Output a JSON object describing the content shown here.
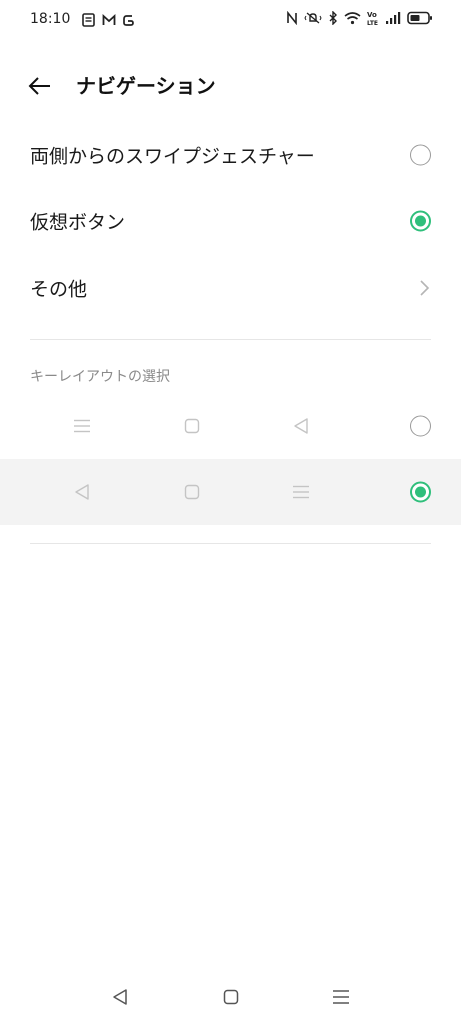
{
  "status_bar": {
    "time": "18:10",
    "left_icons": [
      "notes-icon",
      "gmail-icon",
      "app-icon"
    ],
    "right_icons": [
      "nfc-icon",
      "vibrate-mute-icon",
      "bluetooth-icon",
      "wifi-icon",
      "volte-icon",
      "signal-icon",
      "battery-icon"
    ]
  },
  "header": {
    "title": "ナビゲーション",
    "back_icon": "back-arrow-icon"
  },
  "options": [
    {
      "label": "両側からのスワイプジェスチャー",
      "selected": false
    },
    {
      "label": "仮想ボタン",
      "selected": true
    },
    {
      "label": "その他",
      "type": "link"
    }
  ],
  "key_layout": {
    "title": "キーレイアウトの選択",
    "layouts": [
      {
        "keys": [
          "menu-icon",
          "home-square-icon",
          "back-triangle-icon"
        ],
        "selected": false
      },
      {
        "keys": [
          "back-triangle-icon",
          "home-square-icon",
          "menu-icon"
        ],
        "selected": true
      }
    ]
  },
  "nav_bar": {
    "keys": [
      "back-triangle-icon",
      "home-square-icon",
      "menu-icon"
    ]
  },
  "colors": {
    "accent": "#2fbf7b",
    "selected_row_bg": "#f3f3f3",
    "section_title": "#8a8a8a"
  }
}
